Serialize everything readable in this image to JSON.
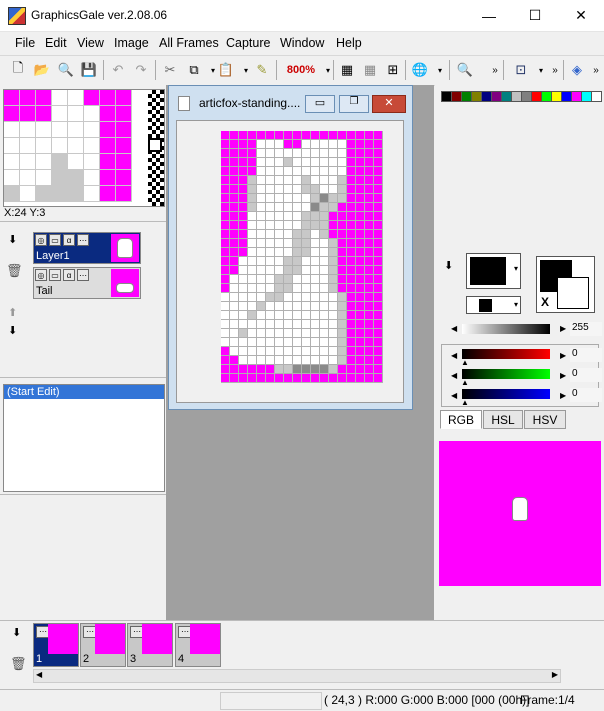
{
  "window": {
    "title": "GraphicsGale ver.2.08.06",
    "minimize": "—",
    "maximize": "☐",
    "close": "✕"
  },
  "menu": [
    "File",
    "Edit",
    "View",
    "Image",
    "All Frames",
    "Capture",
    "Window",
    "Help"
  ],
  "toolbar": {
    "zoom_label": "800%"
  },
  "navigator": {
    "coords": "X:24 Y:3"
  },
  "layers": [
    {
      "name": "Layer1"
    },
    {
      "name": "Tail"
    }
  ],
  "history": {
    "items": [
      "(Start Edit)"
    ]
  },
  "document": {
    "title": "articfox-standing...."
  },
  "palette": {
    "colors": [
      "#000000",
      "#800000",
      "#008000",
      "#808000",
      "#000080",
      "#800080",
      "#008080",
      "#c0c0c0",
      "#808080",
      "#ff0000",
      "#00ff00",
      "#ffff00",
      "#0000ff",
      "#ff00ff",
      "#00ffff",
      "#ffffff"
    ]
  },
  "color": {
    "gray_value": "255",
    "rgb_values": [
      "0",
      "0",
      "0"
    ],
    "tabs": [
      "RGB",
      "HSL",
      "HSV"
    ],
    "active_tab": "RGB",
    "primary": "#000000",
    "secondary": "#ffffff",
    "x_label": "X"
  },
  "frames": [
    {
      "num": "1"
    },
    {
      "num": "2"
    },
    {
      "num": "3"
    },
    {
      "num": "4"
    }
  ],
  "status": {
    "coords": "( 24,3 ) R:000 G:000 B:000  [000 (00h)]",
    "frame": "Frame:1/4"
  }
}
